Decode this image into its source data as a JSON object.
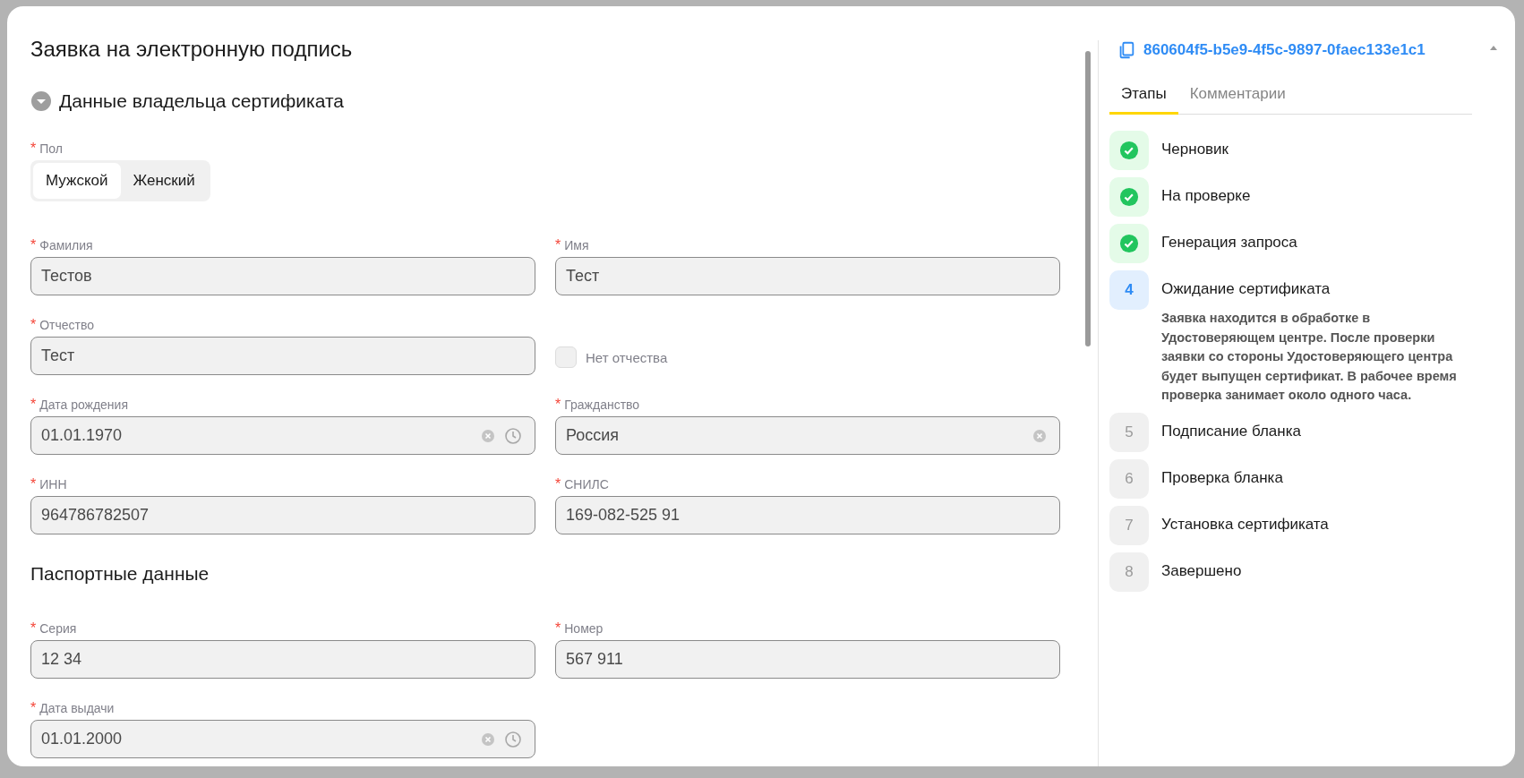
{
  "dialog": {
    "title": "Заявка на электронную подпись"
  },
  "form": {
    "section": {
      "title": "Данные владельца сертификата",
      "expanded": true
    },
    "gender": {
      "label": "Пол",
      "required_mark": "*",
      "options": [
        {
          "label": "Мужской",
          "selected": true
        },
        {
          "label": "Женский",
          "selected": false
        }
      ]
    },
    "rows": [
      [
        {
          "kind": "text",
          "label": "Фамилия",
          "required_mark": "*",
          "value": "Тестов"
        },
        {
          "kind": "text",
          "label": "Имя",
          "required_mark": "*",
          "value": "Тест"
        }
      ],
      [
        {
          "kind": "text",
          "label": "Отчество",
          "required_mark": "*",
          "value": "Тест"
        },
        {
          "kind": "checkbox",
          "label": "Нет отчества",
          "checked": false
        }
      ],
      [
        {
          "kind": "date",
          "label": "Дата рождения",
          "required_mark": "*",
          "value": "01.01.1970"
        },
        {
          "kind": "select",
          "label": "Гражданство",
          "required_mark": "*",
          "value": "Россия"
        }
      ],
      [
        {
          "kind": "text",
          "label": "ИНН",
          "required_mark": "*",
          "value": "964786782507"
        },
        {
          "kind": "text",
          "label": "СНИЛС",
          "required_mark": "*",
          "value": "169-082-525 91"
        }
      ]
    ],
    "passport": {
      "title": "Паспортные данные",
      "rows": [
        [
          {
            "kind": "text",
            "label": "Серия",
            "required_mark": "*",
            "value": "12 34"
          },
          {
            "kind": "text",
            "label": "Номер",
            "required_mark": "*",
            "value": "567 911"
          }
        ],
        [
          {
            "kind": "date",
            "label": "Дата выдачи",
            "required_mark": "*",
            "value": "01.01.2000"
          }
        ]
      ]
    }
  },
  "panel": {
    "request_id": "860604f5-b5e9-4f5c-9897-0faec133e1c1",
    "tabs": [
      {
        "label": "Этапы",
        "selected": true
      },
      {
        "label": "Комментарии",
        "selected": false
      }
    ],
    "stages": [
      {
        "kind": "done",
        "title": "Черновик"
      },
      {
        "kind": "done",
        "title": "На проверке"
      },
      {
        "kind": "done",
        "title": "Генерация запроса"
      },
      {
        "kind": "current",
        "number": "4",
        "title": "Ожидание сертификата",
        "description": "Заявка находится в обработке в Удостоверяющем центре. После проверки заявки со стороны Удостоверяющего центра будет выпущен сертификат. В рабочее время проверка занимает около одного часа."
      },
      {
        "kind": "pending",
        "number": "5",
        "title": "Подписание бланка"
      },
      {
        "kind": "pending",
        "number": "6",
        "title": "Проверка бланка"
      },
      {
        "kind": "pending",
        "number": "7",
        "title": "Установка сертификата"
      },
      {
        "kind": "pending",
        "number": "8",
        "title": "Завершено"
      }
    ]
  }
}
